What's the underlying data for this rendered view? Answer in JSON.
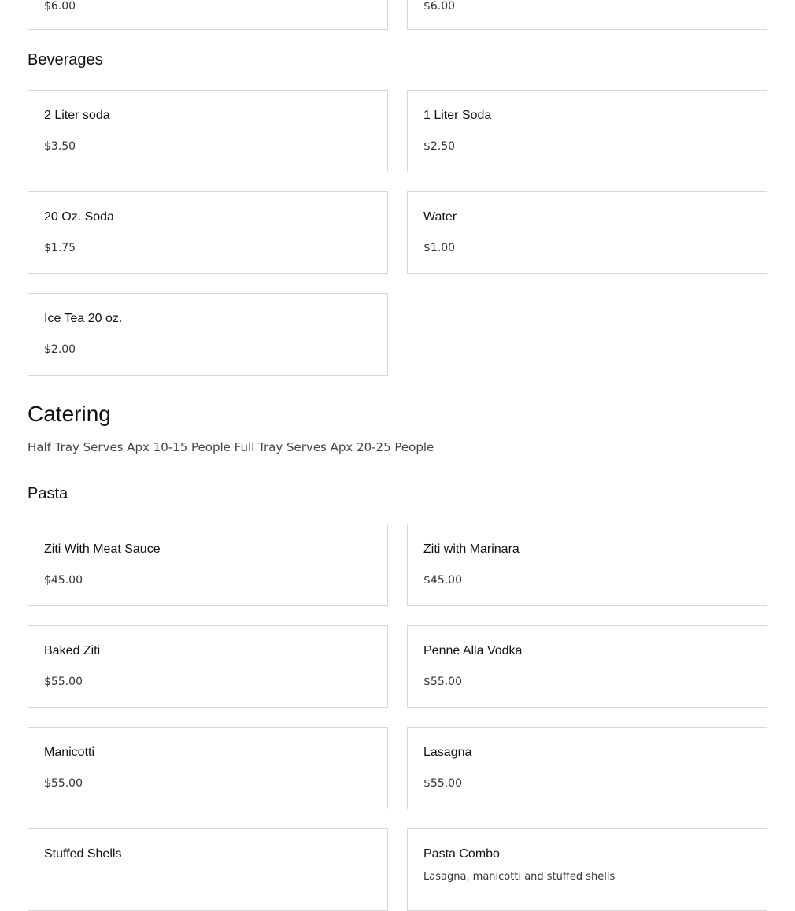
{
  "top_partial": {
    "left_price": "$6.00",
    "right_price": "$6.00"
  },
  "beverages": {
    "title": "Beverages",
    "items": [
      {
        "name": "2 Liter soda",
        "price": "$3.50"
      },
      {
        "name": "1 Liter Soda",
        "price": "$2.50"
      },
      {
        "name": "20 Oz. Soda",
        "price": "$1.75"
      },
      {
        "name": "Water",
        "price": "$1.00"
      },
      {
        "name": "Ice Tea 20 oz.",
        "price": "$2.00"
      }
    ]
  },
  "catering": {
    "title": "Catering",
    "description": "Half Tray Serves Apx 10-15 People Full Tray Serves Apx 20-25 People"
  },
  "pasta": {
    "title": "Pasta",
    "items": [
      {
        "name": "Ziti With Meat Sauce",
        "price": "$45.00"
      },
      {
        "name": "Ziti with Marinara",
        "price": "$45.00"
      },
      {
        "name": "Baked Ziti",
        "price": "$55.00"
      },
      {
        "name": "Penne Alla Vodka",
        "price": "$55.00"
      },
      {
        "name": "Manicotti",
        "price": "$55.00"
      },
      {
        "name": "Lasagna",
        "price": "$55.00"
      },
      {
        "name": "Stuffed Shells",
        "price": ""
      },
      {
        "name": "Pasta Combo",
        "description": "Lasagna, manicotti and stuffed shells"
      }
    ]
  }
}
